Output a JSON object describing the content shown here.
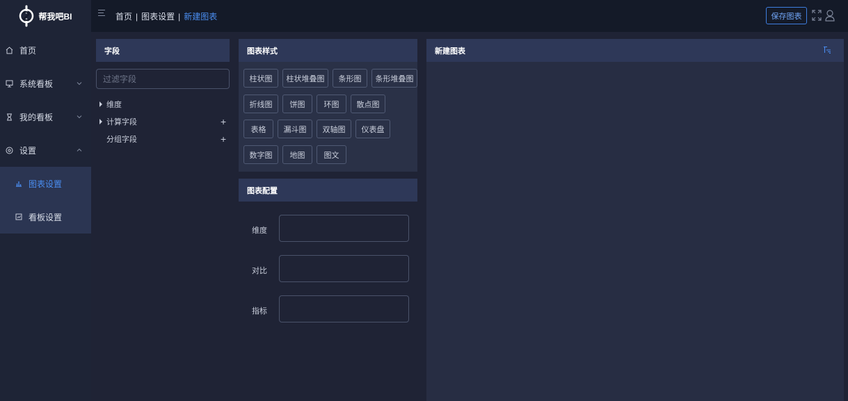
{
  "app": {
    "name": "帮我吧BI"
  },
  "header": {
    "breadcrumb": [
      "首页",
      "图表设置",
      "新建图表"
    ],
    "save_label": "保存图表"
  },
  "sidebar": {
    "items": [
      {
        "label": "首页",
        "icon": "home-icon"
      },
      {
        "label": "系统看板",
        "icon": "monitor-icon"
      },
      {
        "label": "我的看板",
        "icon": "hourglass-icon"
      },
      {
        "label": "设置",
        "icon": "settings-icon"
      }
    ],
    "submenu": [
      {
        "label": "图表设置",
        "icon": "chart-icon",
        "active": true
      },
      {
        "label": "看板设置",
        "icon": "board-icon",
        "active": false
      }
    ]
  },
  "fields": {
    "title": "字段",
    "filter_placeholder": "过滤字段",
    "tree": [
      {
        "label": "维度",
        "expandable": true,
        "addable": false
      },
      {
        "label": "计算字段",
        "expandable": true,
        "addable": true
      },
      {
        "label": "分组字段",
        "expandable": false,
        "addable": true
      }
    ]
  },
  "chart_styles": {
    "title": "图表样式",
    "rows": [
      [
        "柱状图",
        "柱状堆叠图",
        "条形图",
        "条形堆叠图"
      ],
      [
        "折线图",
        "饼图",
        "环图",
        "散点图"
      ],
      [
        "表格",
        "漏斗图",
        "双轴图",
        "仪表盘"
      ],
      [
        "数字图",
        "地图",
        "图文"
      ]
    ]
  },
  "chart_config": {
    "title": "图表配置",
    "fields": [
      "维度",
      "对比",
      "指标"
    ]
  },
  "preview": {
    "title": "新建图表"
  },
  "colors": {
    "accent": "#4a8df0",
    "header_bg": "#141a28",
    "panel_head": "#2e3858",
    "sidebar_bg": "#1e2436",
    "page_bg": "#1f2335"
  }
}
